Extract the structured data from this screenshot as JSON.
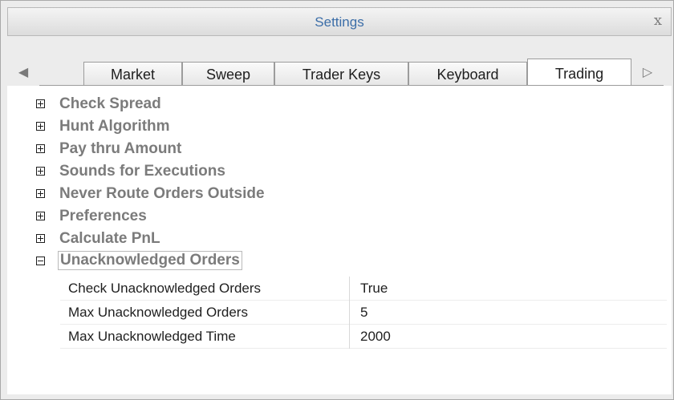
{
  "window": {
    "title": "Settings",
    "close_glyph": "x"
  },
  "tabs": {
    "left_arrow": "◀",
    "right_arrow": "▷",
    "items": [
      {
        "label": "Market"
      },
      {
        "label": "Sweep"
      },
      {
        "label": "Trader Keys"
      },
      {
        "label": "Keyboard"
      },
      {
        "label": "Trading",
        "active": true
      }
    ]
  },
  "groups": [
    {
      "label": "Check Spread",
      "expander": "plus"
    },
    {
      "label": "Hunt Algorithm",
      "expander": "plus"
    },
    {
      "label": "Pay thru Amount",
      "expander": "plus"
    },
    {
      "label": "Sounds for Executions",
      "expander": "plus"
    },
    {
      "label": "Never Route Orders Outside",
      "expander": "plus"
    },
    {
      "label": "Preferences",
      "expander": "plus"
    },
    {
      "label": "Calculate PnL",
      "expander": "plus"
    },
    {
      "label": "Unacknowledged Orders",
      "expander": "minus",
      "selected": true
    }
  ],
  "properties": [
    {
      "name": "Check Unacknowledged Orders",
      "value": "True"
    },
    {
      "name": "Max Unacknowledged Orders",
      "value": "5"
    },
    {
      "name": "Max Unacknowledged Time",
      "value": "2000"
    }
  ]
}
